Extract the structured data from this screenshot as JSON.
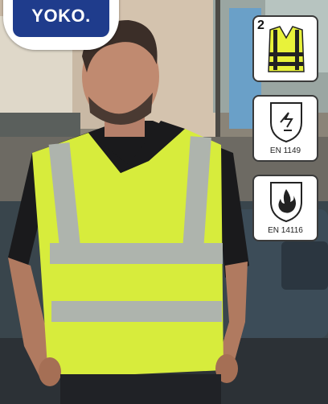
{
  "brand": {
    "logo_text": "YOKO."
  },
  "certifications": [
    {
      "icon": "hi-vis-vest-icon",
      "class_number": "2",
      "caption": ""
    },
    {
      "icon": "antistatic-shield-icon",
      "class_number": "",
      "caption": "EN 1149"
    },
    {
      "icon": "flame-shield-icon",
      "class_number": "",
      "caption": "EN 14116"
    }
  ],
  "colors": {
    "brand_blue": "#1f3c8c",
    "hi_vis_yellow": "#d7ec3c",
    "reflective_grey": "#aeb4ad"
  }
}
